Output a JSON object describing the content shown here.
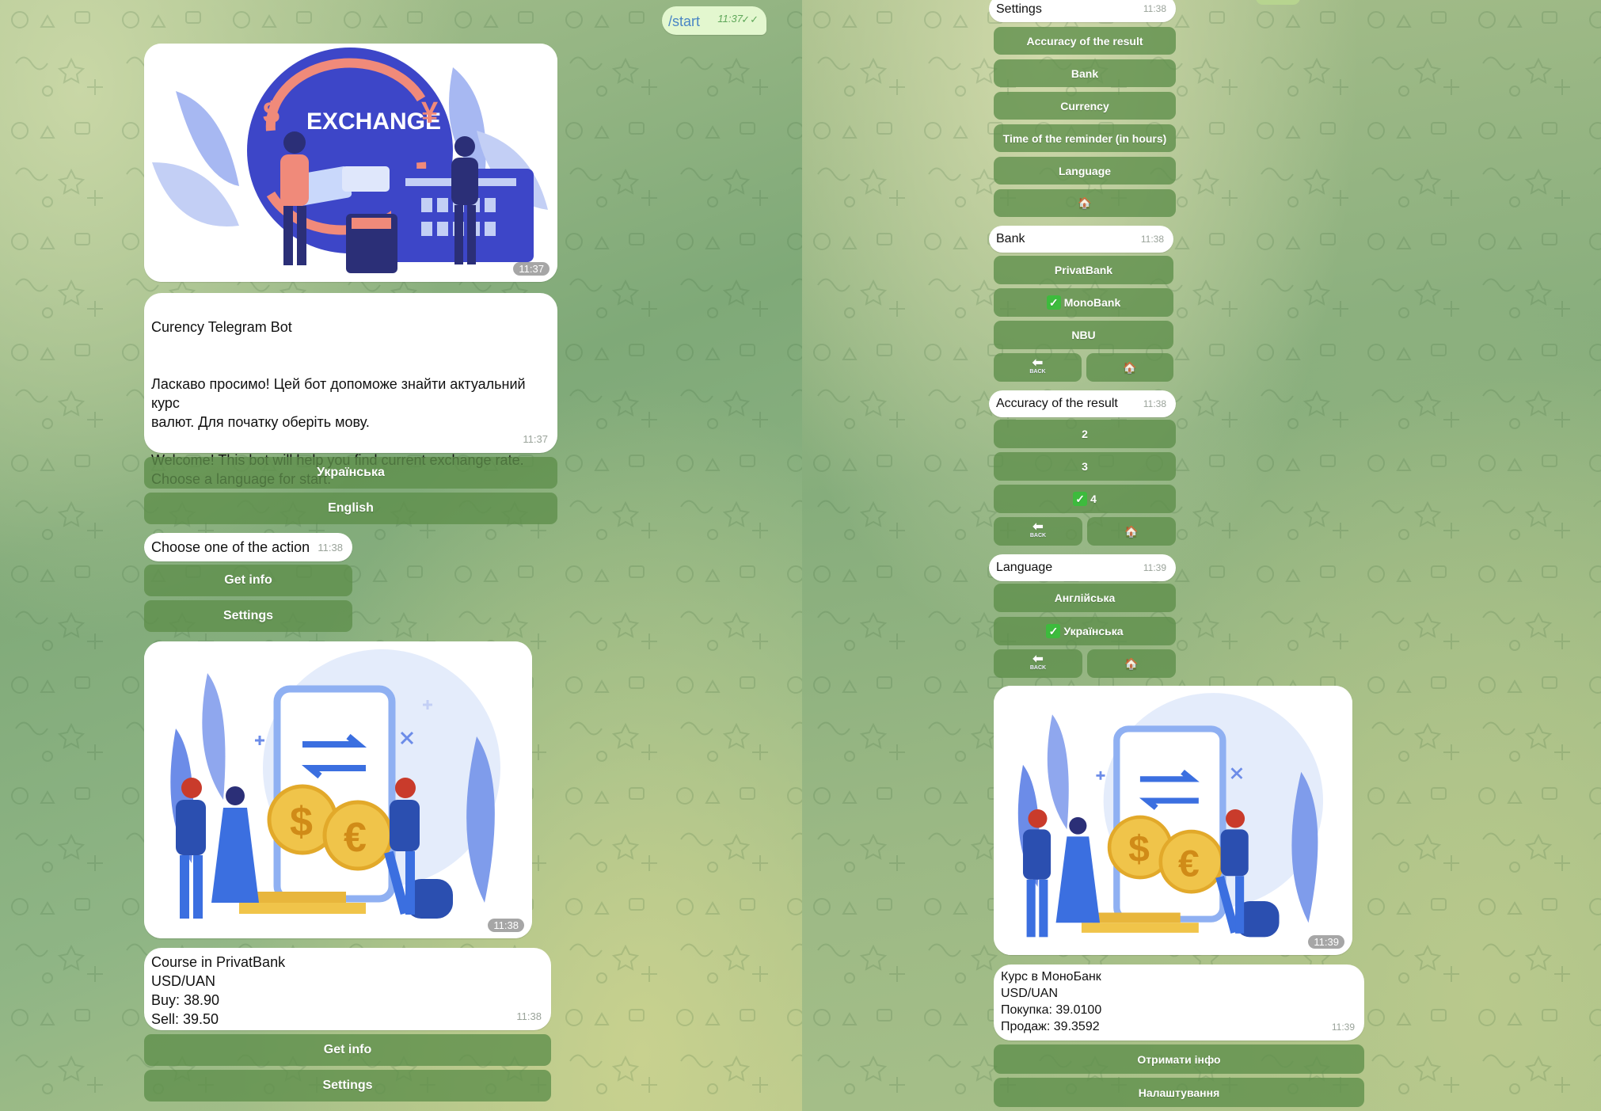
{
  "left": {
    "start_msg": {
      "command": "/start",
      "time": "11:37"
    },
    "photo1": {
      "caption_art": "EXCHANGE",
      "time": "11:37"
    },
    "welcome": {
      "title": "Curency Telegram Bot",
      "body": "Ласкаво просимо! Цей бот допоможе знайти актуальний\nкурс\nвалют. Для початку оберіть мову.\n\nWelcome! This bot will help you find current exchange rate.\nChoose a language for start.",
      "time": "11:37",
      "buttons": [
        "Українська",
        "English"
      ]
    },
    "action": {
      "text": "Choose one of the action",
      "time": "11:38",
      "buttons": [
        "Get info",
        "Settings"
      ]
    },
    "photo2": {
      "time": "11:38"
    },
    "course": {
      "text": "Course in PrivatBank\nUSD/UAN\nBuy: 38.90\nSell: 39.50",
      "time": "11:38",
      "buttons": [
        "Get info",
        "Settings"
      ]
    }
  },
  "right": {
    "settings": {
      "title": "Settings",
      "time": "11:38",
      "buttons": [
        "Accuracy of the result",
        "Bank",
        "Currency",
        "Time of the reminder (in hours)",
        "Language",
        "🏠"
      ]
    },
    "bank": {
      "title": "Bank",
      "time": "11:38",
      "buttons": [
        "PrivatBank",
        "MonoBank",
        "NBU"
      ],
      "selected": "MonoBank",
      "back": "BACK",
      "home": "🏠"
    },
    "accuracy": {
      "title": "Accuracy of the result",
      "time": "11:38",
      "buttons": [
        "2",
        "3",
        "4"
      ],
      "selected": "4",
      "back": "BACK",
      "home": "🏠"
    },
    "language": {
      "title": "Language",
      "time": "11:39",
      "buttons": [
        "Англійська",
        "Українська"
      ],
      "selected": "Українська",
      "back": "BACK",
      "home": "🏠"
    },
    "photo3": {
      "time": "11:39"
    },
    "course": {
      "text": "Курс в МоноБанк\nUSD/UAN\nПокупка: 39.0100\nПродаж: 39.3592",
      "time": "11:39",
      "buttons": [
        "Отримати інфо",
        "Налаштування"
      ]
    }
  },
  "colors": {
    "button_bg": "#5e8e4a",
    "bubble_bg": "#ffffff",
    "outgoing_bg": "#e3f7cf",
    "check_green": "#3dbb3d"
  }
}
